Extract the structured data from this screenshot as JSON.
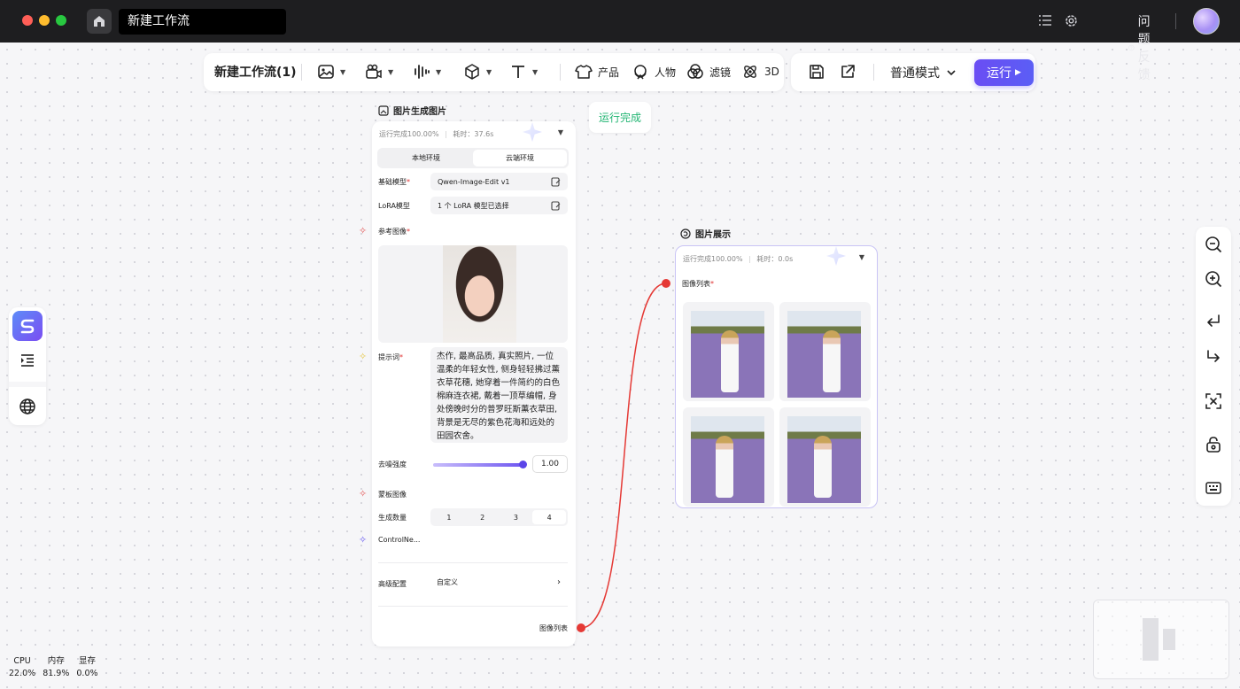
{
  "window": {
    "title": "新建工作流",
    "feedback_label": "问题反馈"
  },
  "toolbar": {
    "workflow_name": "新建工作流(1)",
    "tools": {
      "product": "产品",
      "person": "人物",
      "filter": "滤镜",
      "three_d": "3D"
    },
    "mode": "普通模式",
    "run_label": "运行"
  },
  "status": {
    "run_complete": "运行完成"
  },
  "node_img2img": {
    "title": "图片生成图片",
    "progress": "运行完成100.00%",
    "elapsed": "耗时：37.6s",
    "env_tabs": [
      "本地环境",
      "云端环境"
    ],
    "base_model_label": "基础模型",
    "base_model_value": "Qwen-Image-Edit v1",
    "lora_label": "LoRA模型",
    "lora_value": "1 个 LoRA 模型已选择",
    "ref_image_label": "参考图像",
    "prompt_label": "提示词",
    "prompt_text": "杰作, 最高品质, 真实照片, 一位温柔的年轻女性, 侧身轻轻拂过薰衣草花穗, 她穿着一件简约的白色棉麻连衣裙, 戴着一顶草编帽, 身处傍晚时分的普罗旺斯薰衣草田, 背景是无尽的紫色花海和远处的田园农舍。",
    "denoise_label": "去噪强度",
    "denoise_value": "1.00",
    "denoise_fraction": 1.0,
    "mask_label": "蒙板图像",
    "count_label": "生成数量",
    "count_options": [
      "1",
      "2",
      "3",
      "4"
    ],
    "count_selected": "4",
    "controlnet_label": "ControlNe...",
    "advanced_label": "高级配置",
    "advanced_value": "自定义",
    "output_label": "图像列表"
  },
  "node_display": {
    "title": "图片展示",
    "progress": "运行完成100.00%",
    "elapsed": "耗时：0.0s",
    "input_label": "图像列表"
  },
  "stats": {
    "cpu_label": "CPU",
    "cpu_value": "22.0%",
    "mem_label": "内存",
    "mem_value": "81.9%",
    "gpu_label": "显存",
    "gpu_value": "0.0%"
  },
  "colors": {
    "accent": "#6a4df4",
    "success": "#22b573",
    "required": "#e03030",
    "connection": "#e53935"
  }
}
